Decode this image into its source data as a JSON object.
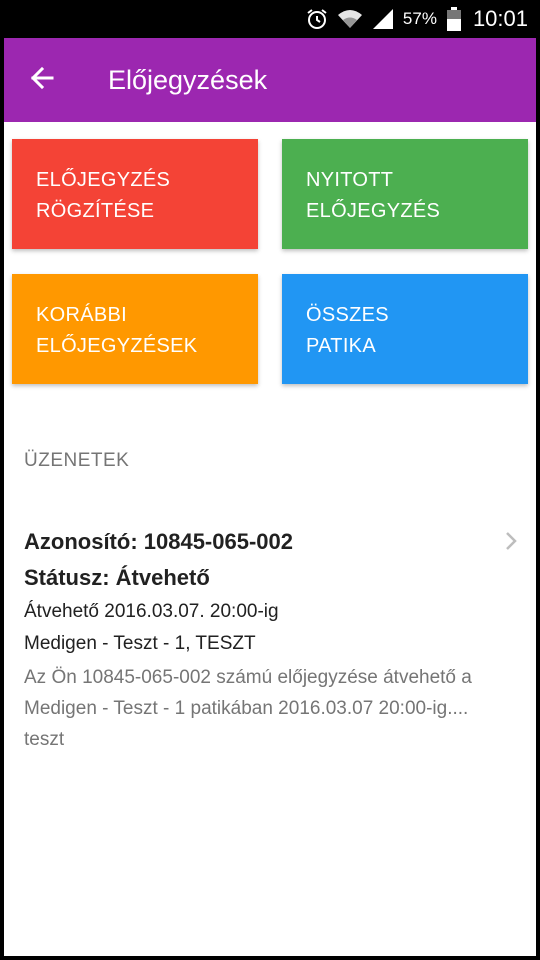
{
  "status_bar": {
    "battery": "57%",
    "time": "10:01",
    "icons": [
      "alarm-icon",
      "wifi-icon",
      "signal-icon",
      "battery-icon"
    ]
  },
  "app_bar": {
    "title": "Előjegyzések",
    "back_icon": "arrow-back-icon",
    "color": "#9c27b0"
  },
  "tiles": [
    {
      "line1": "ELŐJEGYZÉS",
      "line2": "RÖGZÍTÉSE",
      "color": "#f44336"
    },
    {
      "line1": "NYITOTT",
      "line2": "ELŐJEGYZÉS",
      "color": "#4caf50"
    },
    {
      "line1": "KORÁBBI",
      "line2": "ELŐJEGYZÉSEK",
      "color": "#ff9800"
    },
    {
      "line1": "ÖSSZES",
      "line2": "PATIKA",
      "color": "#2196f3"
    }
  ],
  "messages_section": {
    "title": "ÜZENETEK",
    "items": [
      {
        "id_line": "Azonosító: 10845-065-002",
        "status_line": "Státusz: Átvehető",
        "date_line": "Átvehető 2016.03.07. 20:00-ig",
        "pharmacy_line": "Medigen - Teszt - 1, TESZT",
        "body_line1": "Az Ön 10845-065-002 számú előjegyzése átvehető a",
        "body_line2": "Medigen - Teszt - 1 patikában 2016.03.07 20:00-ig....",
        "body_line3": "teszt"
      }
    ]
  }
}
